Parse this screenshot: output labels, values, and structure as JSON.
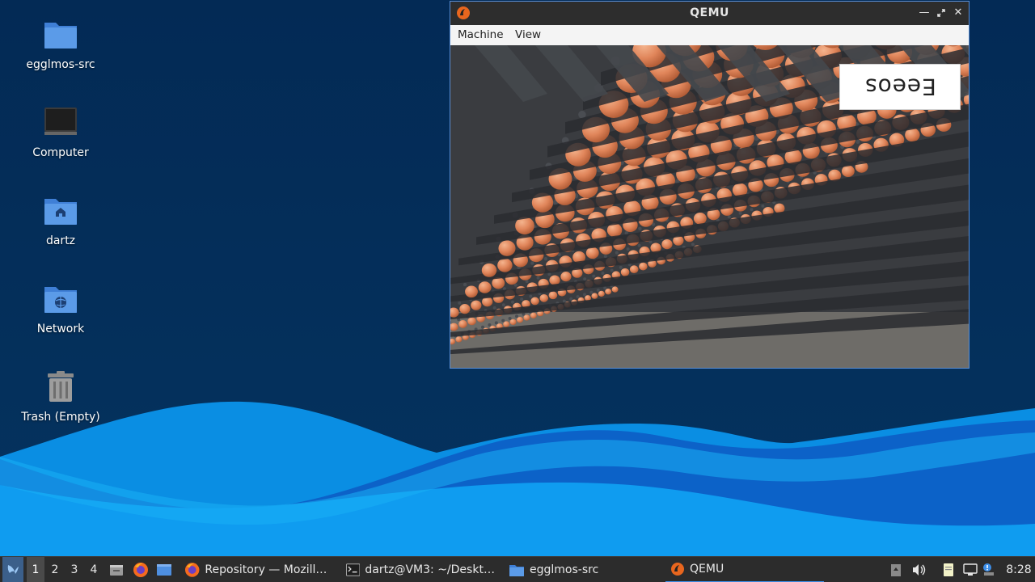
{
  "desktop": {
    "icons": [
      {
        "label": "egglmos-src",
        "icon": "folder-icon"
      },
      {
        "label": "Computer",
        "icon": "computer-icon"
      },
      {
        "label": "dartz",
        "icon": "home-folder-icon"
      },
      {
        "label": "Network",
        "icon": "network-folder-icon"
      },
      {
        "label": "Trash (Empty)",
        "icon": "trash-icon"
      }
    ]
  },
  "qemu_window": {
    "title": "QEMU",
    "menu": [
      "Machine",
      "View"
    ],
    "controls": [
      "minimize-icon",
      "maximize-icon",
      "close-icon"
    ],
    "guest_logo_text": "Eeeos"
  },
  "taskbar": {
    "desktops": [
      "1",
      "2",
      "3",
      "4"
    ],
    "active_desktop": "1",
    "tasks": [
      {
        "label": "Repository — Mozilla ...",
        "icon": "firefox-icon"
      },
      {
        "label": "dartz@VM3: ~/Deskto...",
        "icon": "terminal-icon"
      },
      {
        "label": "egglmos-src",
        "icon": "folder-icon"
      },
      {
        "label": "QEMU",
        "icon": "qemu-icon"
      }
    ],
    "clock": "8:28"
  },
  "colors": {
    "desktop_bg": "#042a52",
    "wave_light": "#1ea7f2",
    "wave_dark": "#0a63c9",
    "taskbar_bg": "#2c2c2c",
    "folder_blue": "#4e8fe0",
    "active_underline": "#3d8ee8"
  }
}
